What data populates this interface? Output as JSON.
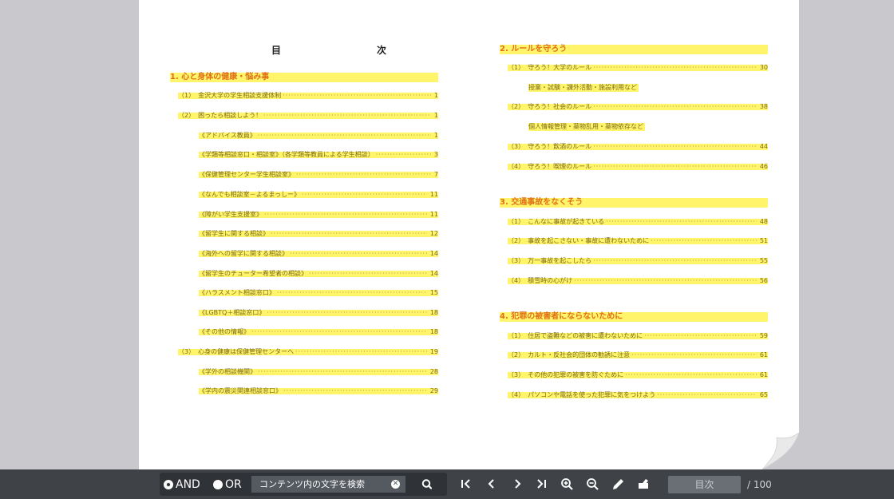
{
  "document": {
    "toc_title": "目　次",
    "left": {
      "sections": [
        {
          "label": "1. 心と身体の健康・悩み事"
        }
      ],
      "entries": [
        {
          "label": "（1）　金沢大学の学生相談支援体制",
          "page": "1"
        },
        {
          "label": "（2）　困ったら相談しよう！",
          "page": "1"
        },
        {
          "label": "《アドバイス教員》",
          "page": "1"
        },
        {
          "label": "《学類等相談窓口・相談室》（各学類等教員による学生相談）",
          "page": "3"
        },
        {
          "label": "《保健管理センター学生相談室》",
          "page": "7"
        },
        {
          "label": "《なんでも相談室－よるまっしー》",
          "page": "11"
        },
        {
          "label": "《障がい学生支援室》",
          "page": "11"
        },
        {
          "label": "《留学生に関する相談》",
          "page": "12"
        },
        {
          "label": "《海外への留学に関する相談》",
          "page": "14"
        },
        {
          "label": "《留学生のチューター希望者の相談》",
          "page": "14"
        },
        {
          "label": "《ハラスメント相談窓口》",
          "page": "15"
        },
        {
          "label": "《LGBTQ＋相談窓口》",
          "page": "18"
        },
        {
          "label": "《その他の情報》",
          "page": "18"
        },
        {
          "label": "（3）　心身の健康は保健管理センターへ",
          "page": "19"
        },
        {
          "label": "《学外の相談機関》",
          "page": "28"
        },
        {
          "label": "《学内の震災関連相談窓口》",
          "page": "29"
        }
      ]
    },
    "right": {
      "sections": [
        {
          "label": "2. ルールを守ろう"
        },
        {
          "label": "3. 交通事故をなくそう"
        },
        {
          "label": "4. 犯罪の被害者にならないために"
        }
      ],
      "entries": [
        {
          "label": "（1）　守ろう！大学のルール",
          "page": "30"
        },
        {
          "label": "授業・試験・課外活動・施設利用など",
          "page": ""
        },
        {
          "label": "（2）　守ろう！社会のルール",
          "page": "38"
        },
        {
          "label": "個人情報管理・薬物乱用・薬物依存など",
          "page": ""
        },
        {
          "label": "（3）　守ろう！飲酒のルール",
          "page": "44"
        },
        {
          "label": "（4）　守ろう！喫煙のルール",
          "page": "46"
        },
        {
          "label": "（1）　こんなに事故が起きている",
          "page": "48"
        },
        {
          "label": "（2）　事故を起こさない・事故に遭わないために",
          "page": "51"
        },
        {
          "label": "（3）　万一事故を起こしたら",
          "page": "55"
        },
        {
          "label": "（4）　積雪時の心がけ",
          "page": "56"
        },
        {
          "label": "（1）　住居で盗難などの被害に遭わないために",
          "page": "59"
        },
        {
          "label": "（2）　カルト・反社会的団体の勧誘に注意",
          "page": "61"
        },
        {
          "label": "（3）　その他の犯罪の被害を防ぐために",
          "page": "61"
        },
        {
          "label": "（4）　パソコンや電話を使った犯罪に気をつけよう",
          "page": "65"
        }
      ]
    }
  },
  "toolbar": {
    "and_label": "AND",
    "or_label": "OR",
    "search_placeholder": "コンテンツ内の文字を検索",
    "page_field": "目次",
    "page_total": "/ 100"
  },
  "colors": {
    "highlight": "#fff46a",
    "section_text": "#e0701a",
    "toolbar_bg": "#3f4348"
  }
}
